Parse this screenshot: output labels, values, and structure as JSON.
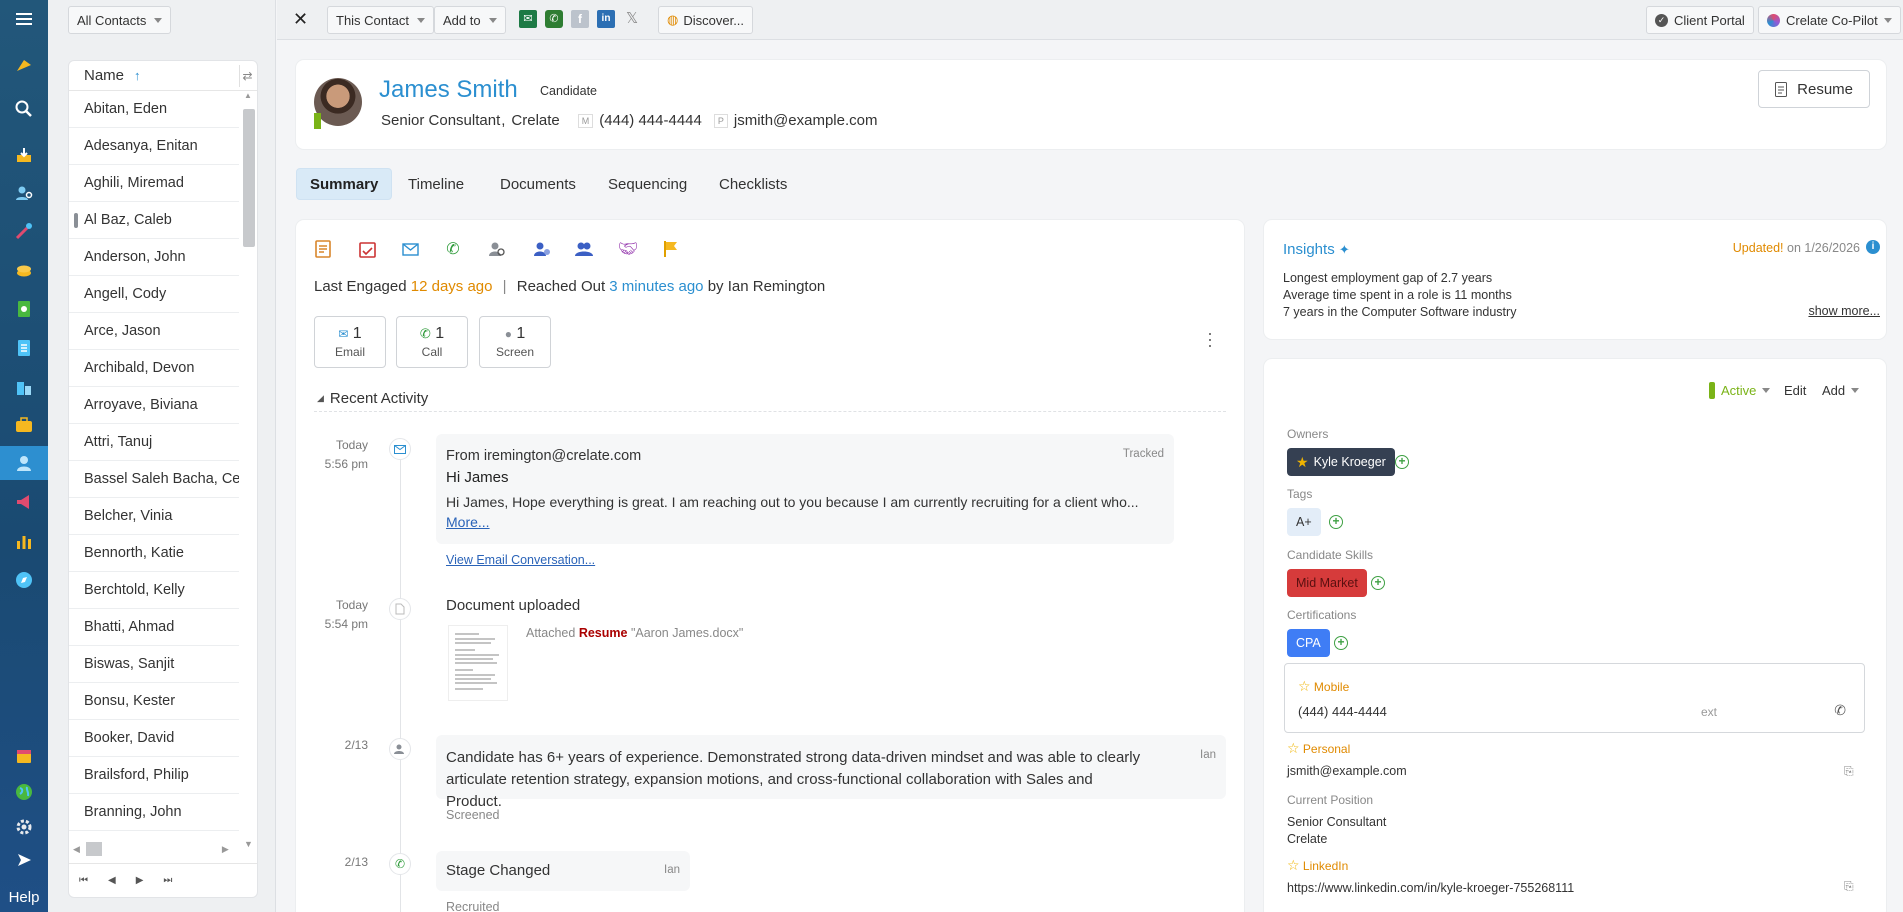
{
  "contacts_panel": {
    "filter_label": "All Contacts",
    "column_header": "Name",
    "sort_indicator": "↑",
    "items": [
      "Abitan, Eden",
      "Adesanya, Enitan",
      "Aghili, Miremad",
      "Al Baz, Caleb",
      "Anderson, John",
      "Angell, Cody",
      "Arce, Jason",
      "Archibald, Devon",
      "Arroyave, Biviana",
      "Attri, Tanuj",
      "Bassel Saleh Bacha, Ce",
      "Belcher, Vinia",
      "Bennorth, Katie",
      "Berchtold, Kelly",
      "Bhatti, Ahmad",
      "Biswas, Sanjit",
      "Bonsu, Kester",
      "Booker, David",
      "Brailsford, Philip",
      "Branning, John"
    ]
  },
  "left_rail": {
    "help_label": "Help"
  },
  "toolbar": {
    "this_contact": "This Contact",
    "add_to": "Add to",
    "discover": "Discover...",
    "client_portal": "Client Portal",
    "copilot": "Crelate Co-Pilot"
  },
  "header": {
    "name": "James Smith",
    "type": "Candidate",
    "title": "Senior Consultant",
    "company": "Crelate",
    "phone_label": "M",
    "phone": "(444) 444-4444",
    "email_label": "P",
    "email": "jsmith@example.com",
    "resume_button": "Resume"
  },
  "tabs": [
    "Summary",
    "Timeline",
    "Documents",
    "Sequencing",
    "Checklists"
  ],
  "engagement": {
    "last_engaged_label": "Last Engaged",
    "last_engaged_value": "12 days ago",
    "separator": "|",
    "reached_out_label": "Reached Out",
    "reached_out_value": "3 minutes ago",
    "by_text": "by Ian Remington"
  },
  "counts": [
    {
      "count": "1",
      "label": "Email"
    },
    {
      "count": "1",
      "label": "Call"
    },
    {
      "count": "1",
      "label": "Screen"
    }
  ],
  "recent_activity": {
    "title": "Recent Activity",
    "items": [
      {
        "date": "Today",
        "time": "5:56 pm",
        "from": "From iremington@crelate.com",
        "status": "Tracked",
        "subject": "Hi James",
        "body": "Hi James, Hope everything is great. I am reaching out to you because I am currently recruiting for a client who...",
        "more": "More...",
        "view_link": "View Email Conversation..."
      },
      {
        "date": "Today",
        "time": "5:54 pm",
        "title": "Document uploaded",
        "attached_label": "Attached",
        "doc_type": "Resume",
        "file": "\"Aaron James.docx\""
      },
      {
        "date": "2/13",
        "text": "Candidate has 6+ years of experience. Demonstrated strong data-driven mindset and was able to clearly articulate retention strategy, expansion motions, and cross-functional collaboration with Sales and Product.",
        "author": "Ian",
        "tag": "Screened"
      },
      {
        "date": "2/13",
        "title": "Stage Changed",
        "author": "Ian",
        "tag": "Recruited"
      }
    ]
  },
  "insights": {
    "title": "Insights",
    "updated_label": "Updated!",
    "updated_date": "on 1/26/2026",
    "lines": [
      "Longest employment gap of 2.7 years",
      "Average time spent in a role is 11 months",
      "7 years in the Computer Software industry"
    ],
    "show_more": "show more..."
  },
  "details": {
    "status": "Active",
    "edit": "Edit",
    "add": "Add",
    "owners_label": "Owners",
    "owner": "Kyle Kroeger",
    "tags_label": "Tags",
    "tag": "A+",
    "skills_label": "Candidate Skills",
    "skill": "Mid Market",
    "certs_label": "Certifications",
    "cert": "CPA",
    "mobile_label": "Mobile",
    "mobile": "(444) 444-4444",
    "ext": "ext",
    "personal_label": "Personal",
    "personal": "jsmith@example.com",
    "position_label": "Current Position",
    "position_title": "Senior Consultant",
    "position_company": "Crelate",
    "linkedin_label": "LinkedIn",
    "linkedin": "https://www.linkedin.com/in/kyle-kroeger-755268111"
  },
  "colors": {
    "accent": "#2b8fd0",
    "orange": "#e08a00",
    "active_green": "#7ab317",
    "owner_chip": "#354052",
    "skill_chip": "#d63b3b",
    "cert_chip": "#3f7df5"
  }
}
